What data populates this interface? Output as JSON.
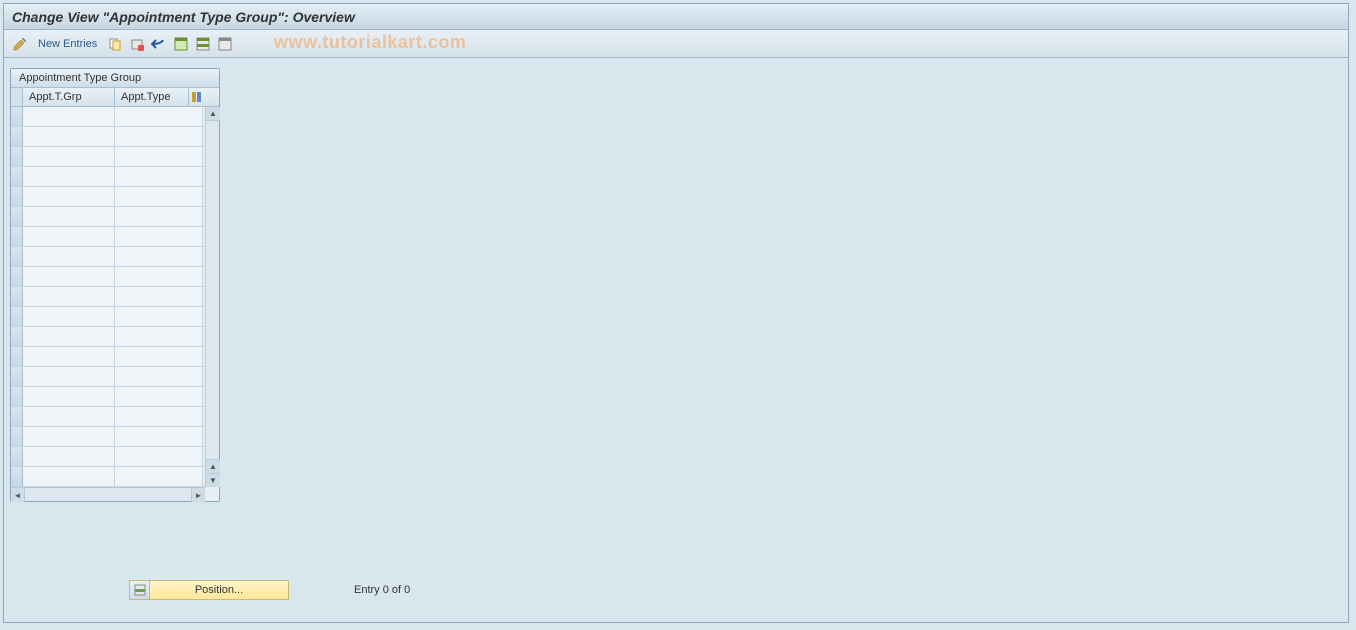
{
  "title": "Change View \"Appointment Type Group\": Overview",
  "toolbar": {
    "new_entries_label": "New Entries"
  },
  "watermark": "www.tutorialkart.com",
  "table": {
    "title": "Appointment Type Group",
    "columns": {
      "col1": "Appt.T.Grp",
      "col2": "Appt.Type"
    },
    "row_count": 19
  },
  "footer": {
    "position_label": "Position...",
    "entry_status": "Entry 0 of 0"
  }
}
